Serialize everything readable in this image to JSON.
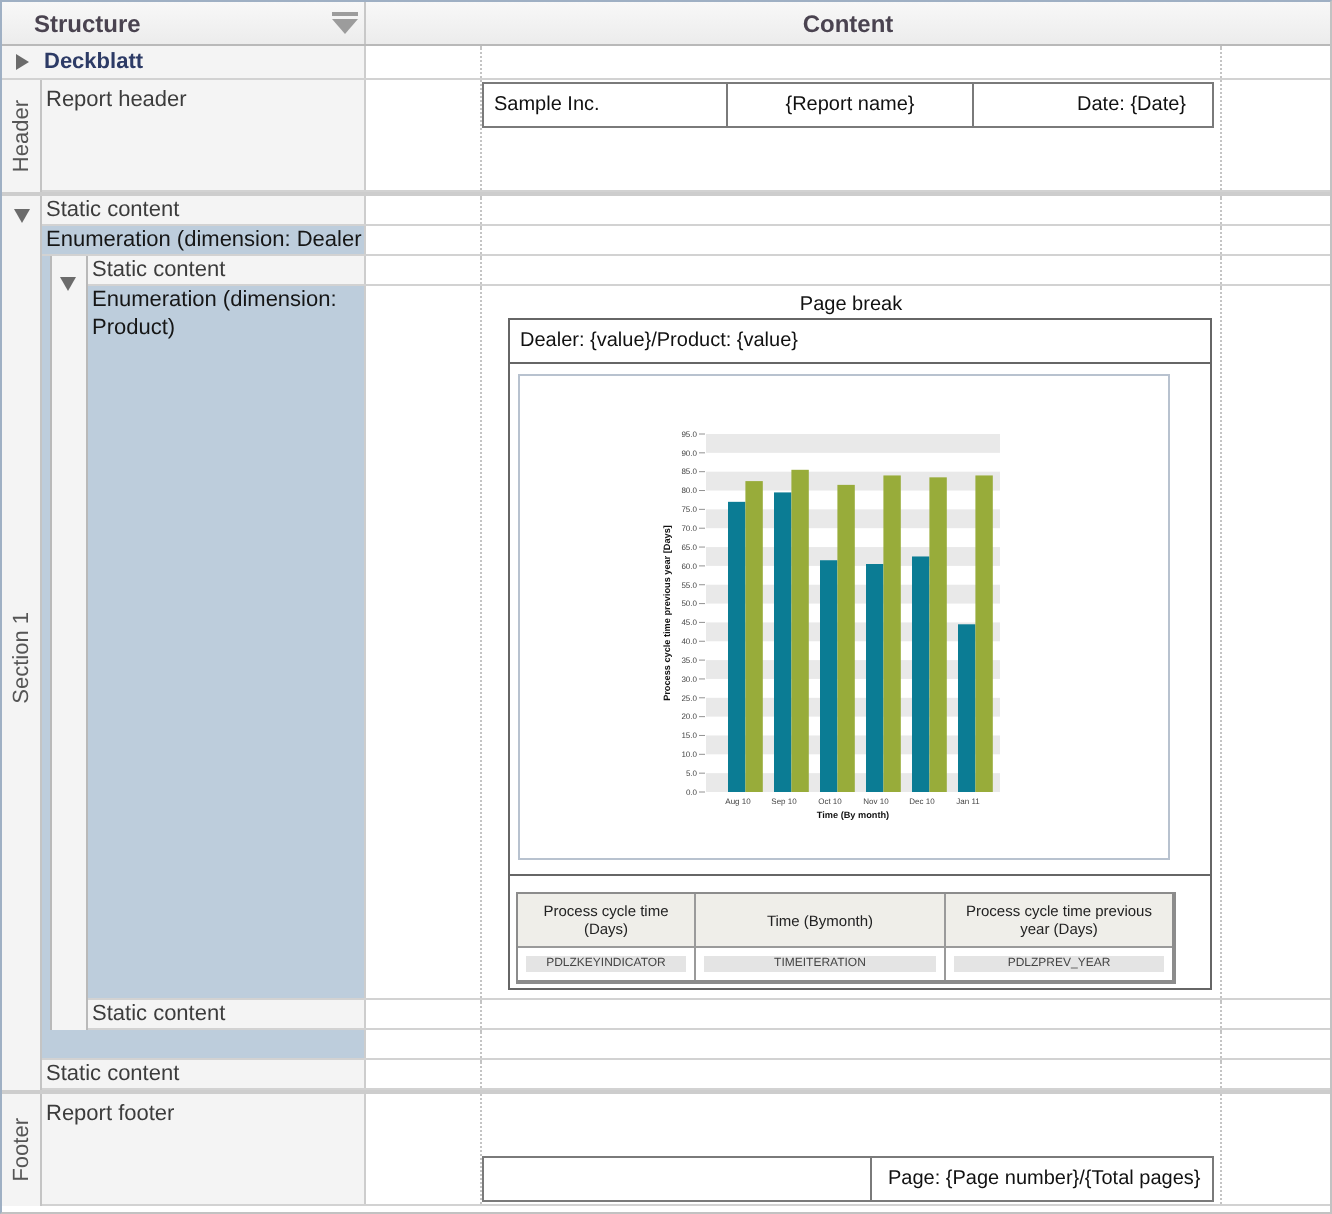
{
  "columns": {
    "structure": "Structure",
    "content": "Content"
  },
  "cover": {
    "label": "Deckblatt",
    "expanded": false
  },
  "header": {
    "title": "Header",
    "row": {
      "label": "Report header",
      "cells": [
        "Sample Inc.",
        "{Report name}",
        "Date: {Date}"
      ]
    }
  },
  "sections": [
    {
      "title": "Section 1",
      "expanded": true,
      "rows": [
        {
          "kind": "static",
          "label": "Static content"
        },
        {
          "kind": "enumeration",
          "label": "Enumeration (dimension: Dealer",
          "expanded": true,
          "children": [
            {
              "kind": "static",
              "label": "Static content"
            },
            {
              "kind": "enumeration",
              "label": "Enumeration (dimension: Product)",
              "content": {
                "page_break": "Page break",
                "title": "Dealer: {value}/Product: {value}",
                "chart_data": {
                  "type": "bar",
                  "xlabel": "Time (By month)",
                  "ylabel": "Process cycle time previous year [Days]",
                  "categories": [
                    "Aug 10",
                    "Sep 10",
                    "Oct 10",
                    "Nov 10",
                    "Dec 10",
                    "Jan 11"
                  ],
                  "series": [
                    {
                      "color": "#0b7c94",
                      "values": [
                        77,
                        79.5,
                        61.5,
                        60.5,
                        62.5,
                        44.5
                      ]
                    },
                    {
                      "color": "#98ac3a",
                      "values": [
                        82.5,
                        85.5,
                        81.5,
                        84,
                        83.5,
                        84
                      ]
                    }
                  ],
                  "ylim": [
                    0,
                    95
                  ],
                  "yticks": [
                    {
                      "value": 0,
                      "label": "0.0"
                    },
                    {
                      "value": 5,
                      "label": "5.0"
                    },
                    {
                      "value": 10,
                      "label": "10.0"
                    },
                    {
                      "value": 15,
                      "label": "15.0"
                    },
                    {
                      "value": 20,
                      "label": "20.0"
                    },
                    {
                      "value": 25,
                      "label": "25.0"
                    },
                    {
                      "value": 30,
                      "label": "30.0"
                    },
                    {
                      "value": 35,
                      "label": "35.0"
                    },
                    {
                      "value": 40,
                      "label": "40.0"
                    },
                    {
                      "value": 45,
                      "label": "45.0"
                    },
                    {
                      "value": 50,
                      "label": "50.0"
                    },
                    {
                      "value": 55,
                      "label": "55.0"
                    },
                    {
                      "value": 60,
                      "label": "60.0"
                    },
                    {
                      "value": 65,
                      "label": "65.0"
                    },
                    {
                      "value": 70,
                      "label": "70.0"
                    },
                    {
                      "value": 75,
                      "label": "75.0"
                    },
                    {
                      "value": 80,
                      "label": "80.0"
                    },
                    {
                      "value": 85,
                      "label": "85.0"
                    },
                    {
                      "value": 90,
                      "label": "90.0"
                    },
                    {
                      "value": 95,
                      "label": "95.0"
                    }
                  ]
                },
                "table": {
                  "columns": [
                    "Process cycle time (Days)",
                    "Time (Bymonth)",
                    "Process cycle time previous year (Days)"
                  ],
                  "fields": [
                    "PDLZKEYINDICATOR",
                    "TIMEITERATION",
                    "PDLZPREV_YEAR"
                  ]
                }
              }
            },
            {
              "kind": "static",
              "label": "Static content"
            }
          ]
        },
        {
          "kind": "static",
          "label": "Static content"
        }
      ]
    }
  ],
  "footer": {
    "title": "Footer",
    "row": {
      "label": "Report footer",
      "page_label": "Page: {Page number}/{Total pages}"
    }
  }
}
